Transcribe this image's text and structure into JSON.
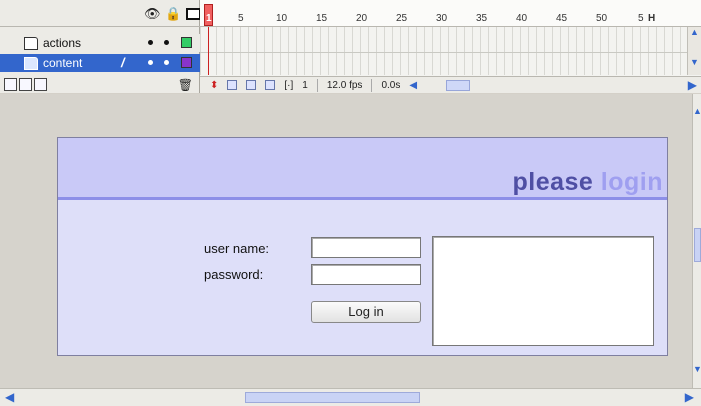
{
  "timeline": {
    "header_icons": [
      "eye-icon",
      "lock-icon",
      "outline-icon"
    ],
    "layers": [
      {
        "name": "actions",
        "selected": false,
        "color": "#33cc66"
      },
      {
        "name": "content",
        "selected": true,
        "color": "#8833cc"
      }
    ],
    "ruler_ticks": [
      "1",
      "5",
      "10",
      "15",
      "20",
      "25",
      "30",
      "35",
      "40",
      "45",
      "50",
      "5"
    ],
    "ruler_end_label": "H",
    "footer": {
      "current_frame": "1",
      "frame_rate": "12.0 fps",
      "elapsed": "0.0s"
    }
  },
  "stage": {
    "banner_word1": "please",
    "banner_word2": "login",
    "banner_color_dark": "#4f4fa4",
    "banner_color_light": "#9f9ff0",
    "username_label": "user name:",
    "username_value": "",
    "password_label": "password:",
    "password_value": "",
    "login_button": "Log in"
  }
}
